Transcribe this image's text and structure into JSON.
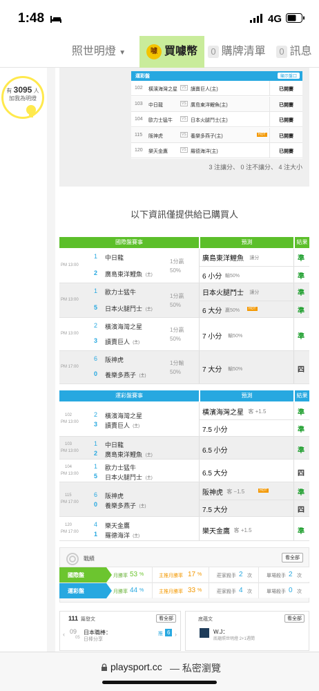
{
  "status": {
    "time": "1:48",
    "network": "4G"
  },
  "nav": {
    "menu": "照世明燈",
    "buy": "買噱幣",
    "buy_icon": "噱",
    "cart_count": "0",
    "cart": "購牌清單",
    "msg_count": "0",
    "msg": "訊息"
  },
  "lamp": {
    "count": "3095",
    "prefix": "有",
    "suffix": "人",
    "sub": "加我為明燈"
  },
  "top_table": {
    "title": "運彩盤",
    "btn": "顯示盤口",
    "rows": [
      {
        "no": "102",
        "a": "橫濱海灣之星",
        "b": "讀賣巨人(主)",
        "hot": "",
        "status": "已開賽"
      },
      {
        "no": "103",
        "a": "中日龍",
        "b": "廣島東洋鯉魚(主)",
        "hot": "",
        "status": "已開賽"
      },
      {
        "no": "104",
        "a": "歐力士猛牛",
        "b": "日本火腿鬥士(主)",
        "hot": "",
        "status": "已開賽"
      },
      {
        "no": "115",
        "a": "阪神虎",
        "b": "養樂多燕子(主)",
        "hot": "HOT",
        "status": "已開賽"
      },
      {
        "no": "120",
        "a": "樂天金鷹",
        "b": "羅德海洋(主)",
        "hot": "",
        "status": "已開賽"
      }
    ],
    "summary": "3 注讓分、 0 注不讓分、 4 注大小"
  },
  "notice": "以下資訊僅提供給已購買人",
  "intl": {
    "h1": "國際盤賽事",
    "h2": "預測",
    "h3": "結果",
    "games": [
      {
        "time": "PM 13:00",
        "n1": "1",
        "t1": "中日龍",
        "n2": "2",
        "t2": "廣島東洋鯉魚",
        "home": "(主)",
        "line1": "1分贏",
        "line2": "50%",
        "p1": "廣島東洋鯉魚",
        "p1s": "讓分",
        "r1": "準",
        "p2": "6 小分",
        "p2s": "輸50%",
        "p2hot": "",
        "r2": "準"
      },
      {
        "time": "PM 13:00",
        "n1": "1",
        "t1": "歐力士猛牛",
        "n2": "5",
        "t2": "日本火腿鬥士",
        "home": "(主)",
        "line1": "1分贏",
        "line2": "50%",
        "p1": "日本火腿鬥士",
        "p1s": "讓分",
        "r1": "準",
        "p2": "6 大分",
        "p2s": "贏50%",
        "p2hot": "HOT",
        "r2": "準"
      },
      {
        "time": "PM 13:00",
        "n1": "2",
        "t1": "橫濱海灣之星",
        "n2": "3",
        "t2": "讀賣巨人",
        "home": "(主)",
        "line1": "1分贏",
        "line2": "50%",
        "p1": "7 小分",
        "p1s": "輸50%",
        "r1": "準",
        "p2": "",
        "p2s": "",
        "p2hot": "",
        "r2": ""
      },
      {
        "time": "PM 17:00",
        "n1": "6",
        "t1": "阪神虎",
        "n2": "0",
        "t2": "養樂多燕子",
        "home": "(主)",
        "line1": "1分輸",
        "line2": "50%",
        "p1": "7 大分",
        "p1s": "輸50%",
        "r1": "四",
        "p2": "",
        "p2s": "",
        "p2hot": "",
        "r2": ""
      }
    ]
  },
  "sport": {
    "h1": "運彩盤賽事",
    "h2": "預測",
    "h3": "結果",
    "games": [
      {
        "no": "102",
        "time": "PM 13:00",
        "n1": "2",
        "t1": "橫濱海灣之星",
        "n2": "3",
        "t2": "讀賣巨人",
        "home": "(主)",
        "p1": "橫濱海灣之星",
        "p1s": "客 +1.5",
        "p1hot": "",
        "r1": "準",
        "p2": "7.5 小分",
        "r2": "準"
      },
      {
        "no": "103",
        "time": "PM 13:00",
        "n1": "1",
        "t1": "中日龍",
        "n2": "2",
        "t2": "廣島東洋鯉魚",
        "home": "(主)",
        "p1": "6.5 小分",
        "p1s": "",
        "p1hot": "",
        "r1": "準",
        "p2": "",
        "r2": ""
      },
      {
        "no": "104",
        "time": "PM 13:00",
        "n1": "1",
        "t1": "歐力士猛牛",
        "n2": "5",
        "t2": "日本火腿鬥士",
        "home": "(主)",
        "p1": "6.5 大分",
        "p1s": "",
        "p1hot": "",
        "r1": "四",
        "p2": "",
        "r2": ""
      },
      {
        "no": "115",
        "time": "PM 17:00",
        "n1": "6",
        "t1": "阪神虎",
        "n2": "0",
        "t2": "養樂多燕子",
        "home": "(主)",
        "p1": "阪神虎",
        "p1s": "客 −1.5",
        "p1hot": "HOT",
        "r1": "準",
        "p2": "7.5 大分",
        "r2": "四"
      },
      {
        "no": "120",
        "time": "PM 17:00",
        "n1": "4",
        "t1": "樂天金鷹",
        "n2": "1",
        "t2": "羅德海洋",
        "home": "(主)",
        "p1": "樂天金鷹",
        "p1s": "客 +1.5",
        "p1hot": "",
        "r1": "準",
        "p2": "",
        "r2": ""
      }
    ]
  },
  "stats": {
    "title": "戰績",
    "btn": "看全部",
    "rows": [
      {
        "label": "國際盤",
        "rate_l": "月勝率",
        "rate": "53",
        "rate2_l": "主推月勝率",
        "rate2": "17",
        "w_l": "莊家殺手",
        "w": "2",
        "w_u": "次",
        "m_l": "單場殺手",
        "m": "2",
        "m_u": "次"
      },
      {
        "label": "運彩盤",
        "rate_l": "月勝率",
        "rate": "44",
        "rate2_l": "主推月勝率",
        "rate2": "33",
        "w_l": "莊家殺手",
        "w": "4",
        "w_u": "次",
        "m_l": "單場殺手",
        "m": "0",
        "m_u": "次"
      }
    ]
  },
  "bottom": {
    "posts_count": "111",
    "posts_label": "篇發文",
    "btn": "看全部",
    "date_d": "09",
    "date_m": "05",
    "post_title": "日本職棒：",
    "post_sub": "日棒分享",
    "tag": "推",
    "tag_n": "6",
    "follow_label": "底蘊文",
    "btn2": "看全部",
    "follow_name": "W.J：",
    "follow_sub": "底蘊照世明燈 2+1週間"
  },
  "url": {
    "domain": "playsport.cc",
    "suffix": "— 私密瀏覽"
  }
}
